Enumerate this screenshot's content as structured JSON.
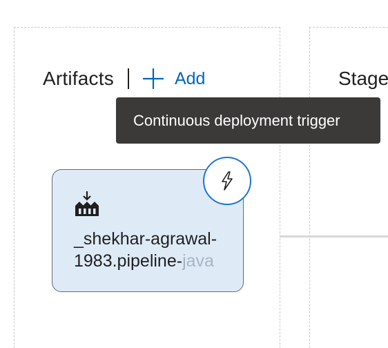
{
  "artifacts": {
    "title": "Artifacts",
    "add_label": "Add",
    "add_icon": "plus-icon"
  },
  "stages": {
    "title": "Stages"
  },
  "tooltip": {
    "text": "Continuous deployment trigger"
  },
  "artifact_card": {
    "name_line1": "_shekhar-agrawal-",
    "name_line2_visible": "1983.pipeline-",
    "name_line2_faded": "java",
    "type_icon": "build-artifact-icon",
    "trigger_icon": "lightning-icon"
  },
  "colors": {
    "accent": "#0066c0",
    "card_background": "#deebf7",
    "tooltip_background": "#3b3a39",
    "trigger_border": "#1a73d8"
  }
}
